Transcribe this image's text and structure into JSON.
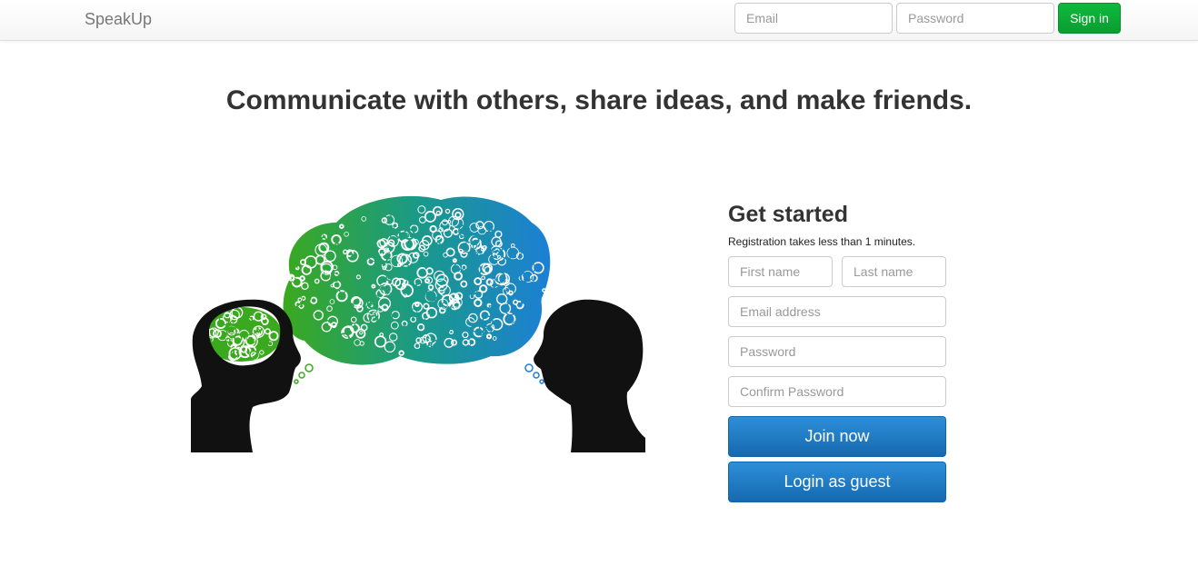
{
  "navbar": {
    "brand": "SpeakUp",
    "email_placeholder": "Email",
    "password_placeholder": "Password",
    "signin_label": "Sign in"
  },
  "headline": "Communicate with others, share ideas, and make friends.",
  "illustration": {
    "icon": "two-heads-speech-bubble-illustration",
    "colors": {
      "green": "#3aa91e",
      "teal": "#1a9a88",
      "blue": "#1c7fd6",
      "silhouette": "#111111"
    }
  },
  "signup": {
    "title": "Get started",
    "subtitle": "Registration takes less than 1 minutes.",
    "first_name_placeholder": "First name",
    "last_name_placeholder": "Last name",
    "email_placeholder": "Email address",
    "password_placeholder": "Password",
    "confirm_password_placeholder": "Confirm Password",
    "join_label": "Join now",
    "guest_label": "Login as guest"
  },
  "colors": {
    "signin_button": "#0fb13a",
    "primary_button": "#1a73bf"
  }
}
